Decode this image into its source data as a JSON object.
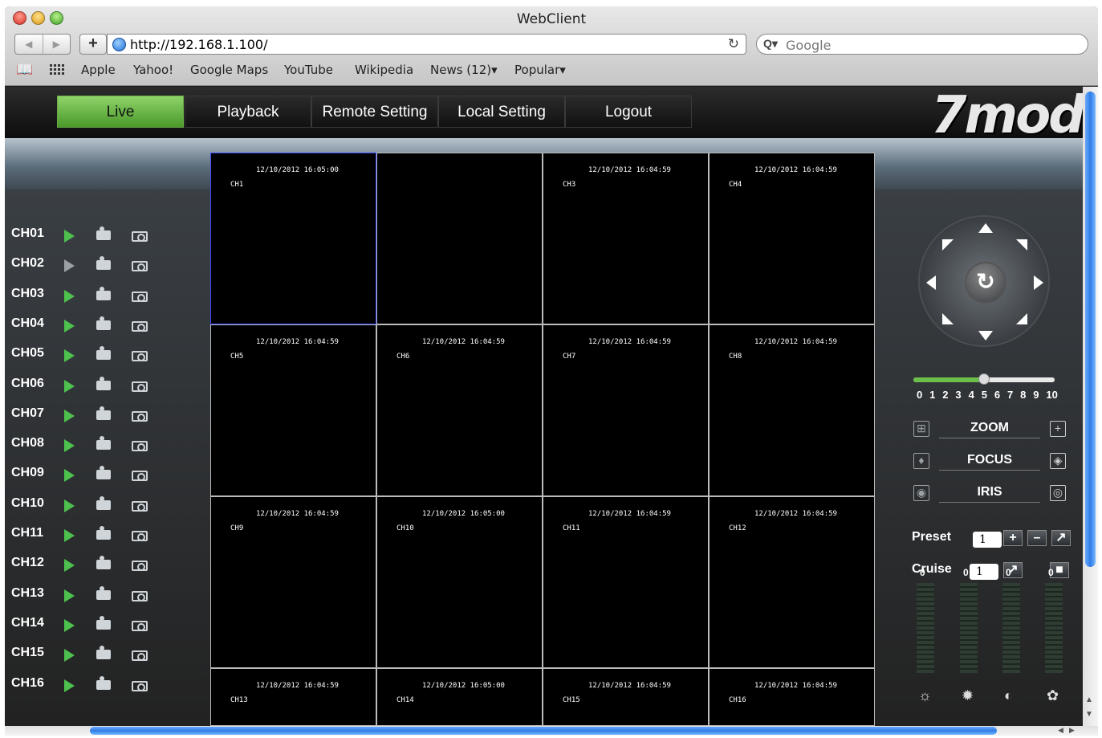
{
  "browser": {
    "title": "WebClient",
    "url": "http://192.168.1.100/",
    "search_placeholder": "Google",
    "bookmarks": [
      "Apple",
      "Yahoo!",
      "Google Maps",
      "YouTube",
      "Wikipedia",
      "News (12)▾",
      "Popular▾"
    ]
  },
  "nav": {
    "tabs": [
      "Live",
      "Playback",
      "Remote Setting",
      "Local Setting",
      "Logout"
    ],
    "active_tab": "Live",
    "logo": "7mod"
  },
  "channels": [
    {
      "name": "CH01",
      "playing": true
    },
    {
      "name": "CH02",
      "playing": false
    },
    {
      "name": "CH03",
      "playing": true
    },
    {
      "name": "CH04",
      "playing": true
    },
    {
      "name": "CH05",
      "playing": true
    },
    {
      "name": "CH06",
      "playing": true
    },
    {
      "name": "CH07",
      "playing": true
    },
    {
      "name": "CH08",
      "playing": true
    },
    {
      "name": "CH09",
      "playing": true
    },
    {
      "name": "CH10",
      "playing": true
    },
    {
      "name": "CH11",
      "playing": true
    },
    {
      "name": "CH12",
      "playing": true
    },
    {
      "name": "CH13",
      "playing": true
    },
    {
      "name": "CH14",
      "playing": true
    },
    {
      "name": "CH15",
      "playing": true
    },
    {
      "name": "CH16",
      "playing": true
    }
  ],
  "video_cells": [
    {
      "time": "12/10/2012 16:05:00",
      "label": "CH1",
      "selected": true
    },
    {
      "time": "",
      "label": "",
      "selected": false
    },
    {
      "time": "12/10/2012 16:04:59",
      "label": "CH3",
      "selected": false
    },
    {
      "time": "12/10/2012 16:04:59",
      "label": "CH4",
      "selected": false
    },
    {
      "time": "12/10/2012 16:04:59",
      "label": "CH5",
      "selected": false
    },
    {
      "time": "12/10/2012 16:04:59",
      "label": "CH6",
      "selected": false
    },
    {
      "time": "12/10/2012 16:04:59",
      "label": "CH7",
      "selected": false
    },
    {
      "time": "12/10/2012 16:04:59",
      "label": "CH8",
      "selected": false
    },
    {
      "time": "12/10/2012 16:04:59",
      "label": "CH9",
      "selected": false
    },
    {
      "time": "12/10/2012 16:05:00",
      "label": "CH10",
      "selected": false
    },
    {
      "time": "12/10/2012 16:04:59",
      "label": "CH11",
      "selected": false
    },
    {
      "time": "12/10/2012 16:04:59",
      "label": "CH12",
      "selected": false
    },
    {
      "time": "12/10/2012 16:04:59",
      "label": "CH13",
      "selected": false
    },
    {
      "time": "12/10/2012 16:05:00",
      "label": "CH14",
      "selected": false
    },
    {
      "time": "12/10/2012 16:04:59",
      "label": "CH15",
      "selected": false
    },
    {
      "time": "12/10/2012 16:04:59",
      "label": "CH16",
      "selected": false
    }
  ],
  "ptz": {
    "speed_ticks": [
      "0",
      "1",
      "2",
      "3",
      "4",
      "5",
      "6",
      "7",
      "8",
      "9",
      "10"
    ],
    "speed_value": 5,
    "zoom_label": "ZOOM",
    "focus_label": "FOCUS",
    "iris_label": "IRIS",
    "preset_label": "Preset",
    "preset_value": "1",
    "cruise_label": "Cruise",
    "cruise_value": "1",
    "meters": [
      "0",
      "0",
      "0",
      "0"
    ]
  },
  "colors": {
    "active_tab": "#6cc04a",
    "play_icon": "#4ec04e",
    "selection": "#3a4cff",
    "scroll_thumb": "#2f7de6"
  }
}
